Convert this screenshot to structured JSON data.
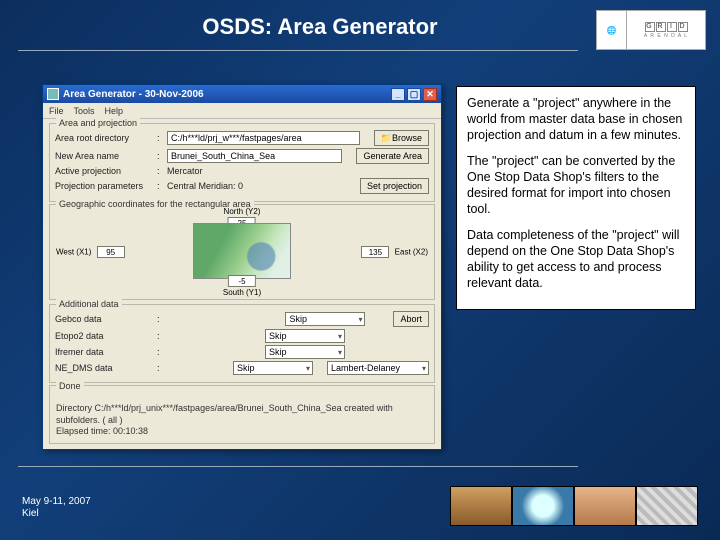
{
  "title": "OSDS: Area Generator",
  "logo": {
    "brand": "GRID",
    "sub": "A R E N D A L"
  },
  "app": {
    "title": "Area Generator - 30-Nov-2006",
    "menu": [
      "File",
      "Tools",
      "Help"
    ],
    "proj_panel": {
      "title": "Area and projection",
      "root_lbl": "Area root directory",
      "root_val": "C:/h***ld/prj_w***/fastpages/area",
      "browse": "Browse",
      "name_lbl": "New Area name",
      "name_val": "Brunei_South_China_Sea",
      "generate": "Generate Area",
      "proj_lbl": "Active projection",
      "proj_val": "Mercator",
      "params_lbl": "Projection parameters",
      "params_val": "Central Meridian: 0",
      "setproj": "Set projection"
    },
    "map_panel": {
      "title": "Geographic coordinates for the rectangular area",
      "n_lbl": "North (Y2)",
      "n_val": "25",
      "s_lbl": "South (Y1)",
      "s_val": "-5",
      "w_lbl": "West (X1)",
      "w_val": "95",
      "e_lbl": "East (X2)",
      "e_val": "135"
    },
    "add_panel": {
      "title": "Additional data",
      "rows": [
        {
          "lbl": "Gebco data",
          "val": "Skip"
        },
        {
          "lbl": "Etopo2 data",
          "val": "Skip"
        },
        {
          "lbl": "Ifremer data",
          "val": "Skip"
        },
        {
          "lbl": "NE_DMS data",
          "val": "Skip"
        }
      ],
      "abort": "Abort",
      "proj_sel": "Lambert-Delaney"
    },
    "done": {
      "title": "Done",
      "line1": "Directory C:/h***ld/prj_unix***/fastpages/area/Brunei_South_China_Sea created with subfolders. ( all )",
      "line2": "Elapsed time: 00:10:38"
    }
  },
  "side": {
    "p1": "Generate a \"project\" anywhere in the world from master data base in chosen projection and datum in a few minutes.",
    "p2": "The \"project\" can be converted by the One Stop Data Shop's filters to the desired format for import into chosen tool.",
    "p3": "Data completeness of the \"project\" will depend on the One Stop Data Shop's ability to get access to and process relevant data."
  },
  "footer": {
    "date": "May 9-11, 2007",
    "place": "Kiel"
  }
}
